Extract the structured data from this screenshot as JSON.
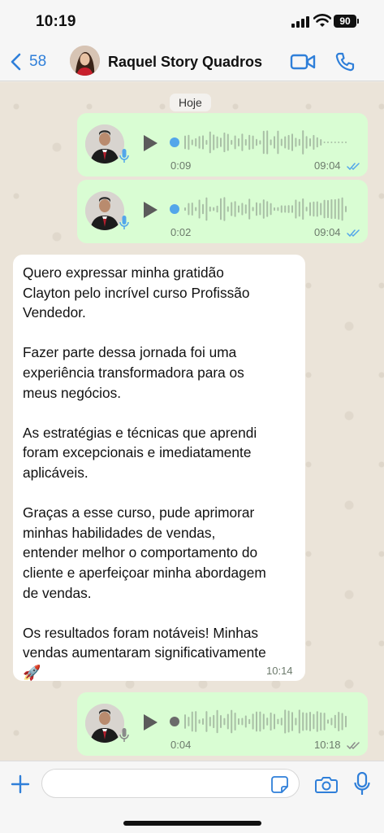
{
  "status_bar": {
    "time": "10:19",
    "battery": "90"
  },
  "header": {
    "back_count": "58",
    "contact_name": "Raquel Story Quadros",
    "icons": [
      "chevron-left-icon",
      "video-call-icon",
      "phone-call-icon"
    ]
  },
  "chat": {
    "day_label": "Hoje",
    "voice_messages": [
      {
        "duration": "0:09",
        "time": "09:04",
        "played": true
      },
      {
        "duration": "0:02",
        "time": "09:04",
        "played": true
      },
      {
        "duration": "0:04",
        "time": "10:18",
        "played": false
      }
    ],
    "text_message": {
      "text": "Quero expressar minha gratidão\nClayton pelo incrível curso Profissão\nVendedor.\n\nFazer parte dessa jornada foi uma\nexperiência transformadora para os\nmeus negócios.\n\nAs estratégias e técnicas que aprendi\nforam excepcionais e imediatamente\naplicáveis.\n\nGraças a esse curso, pude aprimorar\nminhas habilidades de vendas,\nentender melhor o comportamento do\ncliente e aperfeiçoar minha abordagem\nde vendas.\n\nOs resultados foram notáveis! Minhas\nvendas aumentaram significativamente",
      "emoji": "🚀",
      "time": "10:14"
    }
  },
  "colors": {
    "accent": "#2f7fd9",
    "outgoing_bubble": "#d9fdd3",
    "incoming_bubble": "#ffffff",
    "played_dot": "#53a6ea",
    "unplayed_dot": "#6b6b6b",
    "read_ticks": "#53a6ea"
  },
  "input_bar": {
    "icons": [
      "plus-icon",
      "sticker-icon",
      "camera-icon",
      "microphone-icon"
    ]
  }
}
